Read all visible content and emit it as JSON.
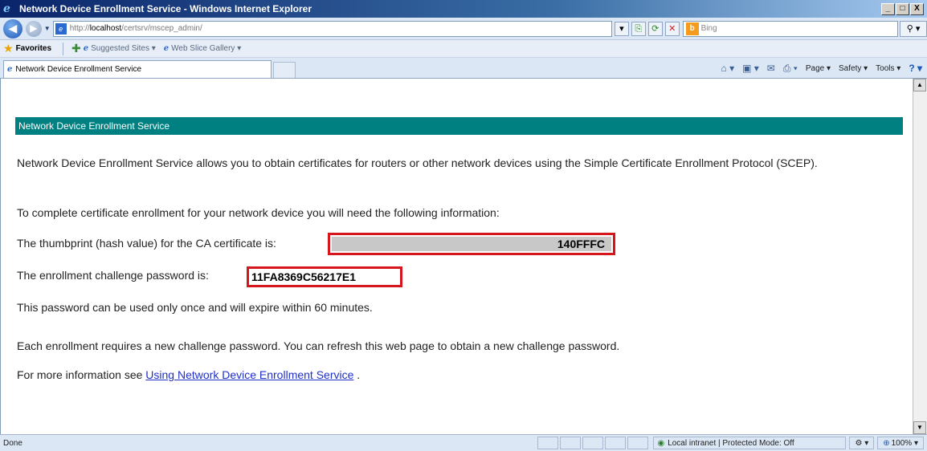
{
  "window": {
    "title": "Network Device Enrollment Service - Windows Internet Explorer",
    "buttons": [
      "_",
      "□",
      "X"
    ]
  },
  "navbar": {
    "url_prefix": "http://",
    "url_host": "localhost",
    "url_path": "/certsrv/mscep_admin/",
    "search_placeholder": "Bing"
  },
  "favorites": {
    "label": "Favorites",
    "links": [
      "Suggested Sites ▾",
      "Web Slice Gallery ▾"
    ]
  },
  "tab": {
    "label": "Network Device Enrollment Service"
  },
  "commandbar": {
    "page": "Page ▾",
    "safety": "Safety ▾",
    "tools": "Tools ▾"
  },
  "page": {
    "banner": "Network Device Enrollment Service",
    "intro": "Network Device Enrollment Service allows you to obtain certificates for routers or other network devices using the Simple Certificate Enrollment Protocol (SCEP).",
    "need_info": "To complete certificate enrollment for your network device you will need the following information:",
    "thumbprint_label": "The thumbprint (hash value) for the CA certificate is:",
    "thumbprint_value": "140FFFC",
    "password_label": "The enrollment challenge password is:",
    "password_value": "11FA8369C56217E1",
    "once_note": "This password can be used only once and will expire within 60 minutes.",
    "each_note": "Each enrollment requires a new challenge password. You can refresh this web page to obtain a new challenge password.",
    "more_info_prefix": "For more information see",
    "more_info_link": "Using Network Device Enrollment Service",
    "more_info_suffix": "."
  },
  "status": {
    "text": "Done",
    "zone": "Local intranet | Protected Mode: Off",
    "zoom": "100%"
  }
}
